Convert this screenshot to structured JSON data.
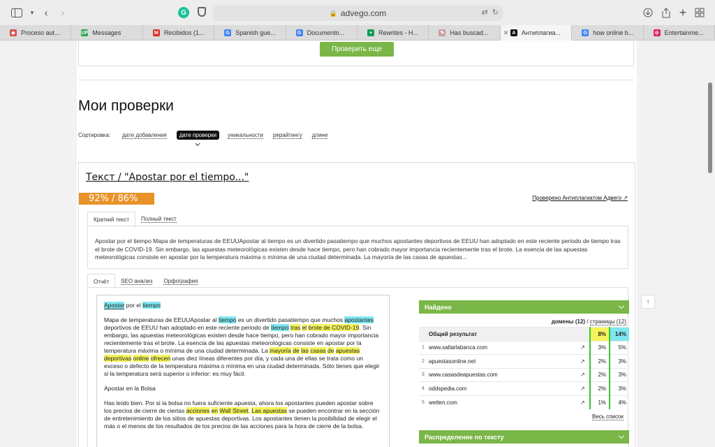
{
  "browser": {
    "url": "advego.com",
    "tabs": [
      {
        "label": "Proceso aut...",
        "color": "#d9534f",
        "glyph": "◆"
      },
      {
        "label": "Messages",
        "color": "#2fa84f",
        "glyph": "UP"
      },
      {
        "label": "Recibidos (1...",
        "color": "#d93025",
        "glyph": "M"
      },
      {
        "label": "Spanish gue...",
        "color": "#4285f4",
        "glyph": "G"
      },
      {
        "label": "Documento...",
        "color": "#4285f4",
        "glyph": "G"
      },
      {
        "label": "Rewrites - H...",
        "color": "#0f9d58",
        "glyph": "+"
      },
      {
        "label": "Has buscad...",
        "color": "#c9a0a0",
        "glyph": "✎"
      },
      {
        "label": "Антиплагиа...",
        "color": "#111111",
        "glyph": "A"
      },
      {
        "label": "how online b...",
        "color": "#4285f4",
        "glyph": "G"
      },
      {
        "label": "Entertainme...",
        "color": "#e0245e",
        "glyph": "⊘"
      }
    ]
  },
  "top": {
    "check_again": "Проверить еще"
  },
  "page_title": "Мои проверки",
  "sort": {
    "label": "Сортировка:",
    "options": [
      "дате добавления",
      "дате проверки",
      "уникальности",
      "рерайтингу",
      "длине"
    ]
  },
  "card": {
    "title": "Текст / \"Apostar por el tiempo...\"",
    "score": "92% / 86%",
    "verified": "Проверено Антиплагиатом Адвего",
    "tabs": [
      "Краткий текст",
      "Полный текст"
    ],
    "summary": "Apostar por el tiempo Mapa de temperaturas de EEUUApostar al tiempo es un divertido pasatiempo que muchos apostantes deportivos de EEUU han adoptado en este reciente periodo de tiempo tras el brote de COVID-19. Sin embargo, las apuestas meteorológicas existen desde hace tiempo, pero han cobrado mayor importancia recientemente tras el brote. La esencia de las apuestas meteorológicas consiste en apostar por la temperatura máxima o mínima de una ciudad determinada. La mayoría de las casas de apuestas...",
    "report_tabs": [
      "Отчёт",
      "SEO анализ",
      "Орфография"
    ]
  },
  "report": {
    "p1": {
      "w1": "Apostar",
      "w2": " por el ",
      "w3": "tiempo"
    },
    "p2": {
      "a": "Mapa de temperaturas de EEUUApostar al ",
      "b": "tiempo",
      "c": " es un divertido pasatiempo que muchos ",
      "d": "apostantes",
      "e": " deportivos de EEUU han adoptado en este reciente periodo de ",
      "f": "tiempo",
      "g": " ",
      "h": "tras",
      "i": " ",
      "j": "el",
      "k": " ",
      "l": "brote de COVID-19",
      "m": ". Sin embargo, las apuestas meteorológicas existen desde hace tiempo, pero han cobrado mayor importancia recientemente tras el brote. La esencia de las apuestas meteorológicas consiste en apostar por la temperatura máxima o mínima de una ciudad determinada. La ",
      "n": "mayoría",
      "o": " ",
      "p": "de",
      "q": " ",
      "r": "las",
      "s": " ",
      "t": "casas",
      "u": " ",
      "v": "de",
      "w": " ",
      "x": "apuestas",
      "y": " ",
      "z": "deportivas",
      "aa": " ",
      "ab": "online",
      "ac": " ",
      "ad": "ofrecen",
      "ae": " unas diez líneas diferentes por día, y cada una de ellas se trata como un exceso o defecto de la temperatura máxima o mínima en una ciudad determinada. Sólo tienes que elegir si la temperatura será superior o inferior: es muy fácil."
    },
    "p3": "Apostar en la Bolsa",
    "p4": {
      "a": "Has leído bien. Por si la bolsa no fuera suficiente apuesta, ahora los apostantes pueden apostar sobre los precios de cierre de ciertas ",
      "b": "acciones",
      "c": " ",
      "d": "en",
      "e": " ",
      "f": "Wall Street",
      "g": ". ",
      "h": "Las apuestas",
      "i": " se pueden encontrar en la sección de entretenimiento de los sitios de apuestas deportivas. Los apostantes tienen la posibilidad de elegir el más o el menos de los resultados de los precios de las acciones para la hora de cierre de la bolsa."
    }
  },
  "found": {
    "title": "Найдено",
    "domains_label": "домены (12)",
    "sep": " / ",
    "pages_label": "страницы (12)",
    "total_label": "Общий результат",
    "total_c1": "8%",
    "total_c2": "14%",
    "rows": [
      {
        "n": "1",
        "domain": "www.saltarlabanca.com",
        "c1": "3%",
        "c2": "5%"
      },
      {
        "n": "2",
        "domain": "apuestasonline.net",
        "c1": "2%",
        "c2": "3%"
      },
      {
        "n": "3",
        "domain": "www.casasdeapuestas.com",
        "c1": "2%",
        "c2": "3%"
      },
      {
        "n": "4",
        "domain": "oddspedia.com",
        "c1": "2%",
        "c2": "3%"
      },
      {
        "n": "5",
        "domain": "wetten.com",
        "c1": "1%",
        "c2": "4%"
      }
    ],
    "all_list": "Весь список"
  },
  "distribution": {
    "title": "Распределение по тексту"
  }
}
